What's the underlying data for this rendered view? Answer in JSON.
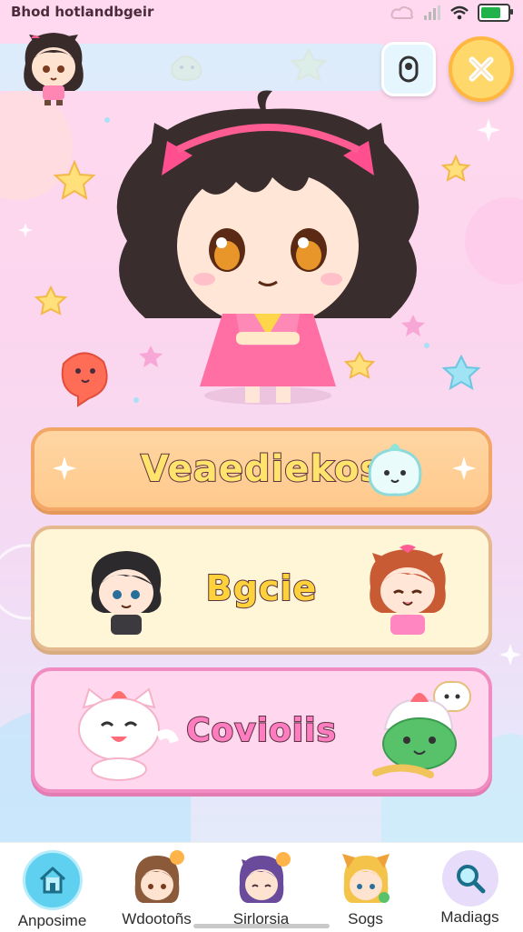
{
  "status_bar": {
    "title": "Bhod hotlandbgeir",
    "icons": [
      "cloud-icon",
      "signal-icon",
      "wifi-icon",
      "battery-icon"
    ],
    "battery_level": 0.8
  },
  "header": {
    "avatar": "chibi-girl-avatar",
    "pill_icon": "toggle-icon",
    "close_icon": "close-icon"
  },
  "hero": {
    "character": "chibi-girl-cat-ears"
  },
  "menu": {
    "items": [
      {
        "label": "Veaediekos",
        "icon": "ghost-blob-icon"
      },
      {
        "label": "Bgcie",
        "icon": "chibi-pair-icon"
      },
      {
        "label": "Covioiis",
        "icon": "cat-and-frog-icon"
      }
    ]
  },
  "bottom_nav": {
    "items": [
      {
        "label": "Anposime",
        "icon": "home-icon"
      },
      {
        "label": "Wdootoñs",
        "icon": "brown-hair-avatar-icon"
      },
      {
        "label": "Sirlorsia",
        "icon": "purple-hair-avatar-icon"
      },
      {
        "label": "Sogs",
        "icon": "blonde-avatar-icon"
      },
      {
        "label": "Madiags",
        "icon": "search-icon"
      }
    ]
  },
  "colors": {
    "background": "#ffd9ef",
    "card1": "#ffc98c",
    "card2": "#fff6d8",
    "card3": "#ffd7ee",
    "close_button": "#ffd86b",
    "home_button": "#5fd0f0"
  }
}
